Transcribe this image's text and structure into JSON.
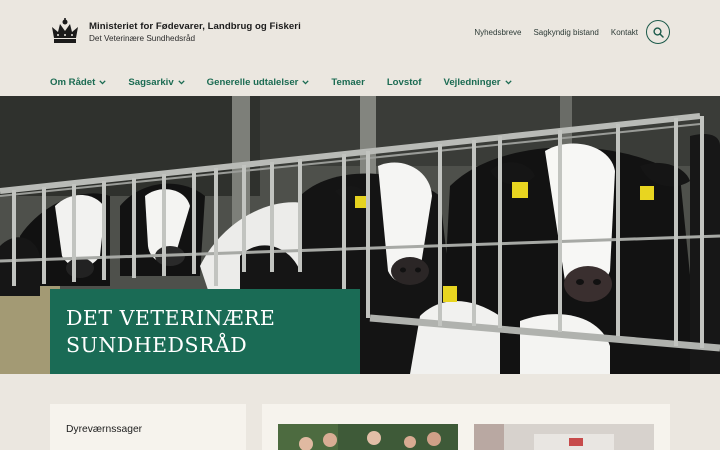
{
  "header": {
    "title": "Ministeriet for Fødevarer, Landbrug og Fiskeri",
    "subtitle": "Det Veterinære Sundhedsråd",
    "top_links": [
      "Nyhedsbreve",
      "Sagkyndig bistand",
      "Kontakt"
    ]
  },
  "nav": {
    "items": [
      {
        "label": "Om Rådet",
        "dropdown": true
      },
      {
        "label": "Sagsarkiv",
        "dropdown": true
      },
      {
        "label": "Generelle udtalelser",
        "dropdown": true
      },
      {
        "label": "Temaer",
        "dropdown": false
      },
      {
        "label": "Lovstof",
        "dropdown": false
      },
      {
        "label": "Vejledninger",
        "dropdown": true
      }
    ]
  },
  "hero": {
    "title": "DET VETERINÆRE SUNDHEDSRÅD"
  },
  "cards": {
    "left_title": "Dyreværnssager"
  },
  "colors": {
    "accent": "#1a6b55",
    "background": "#ebe7e0",
    "card": "#f6f3ed"
  },
  "icons": {
    "logo": "crown-icon",
    "search": "search-icon",
    "dropdown": "chevron-down-icon"
  }
}
